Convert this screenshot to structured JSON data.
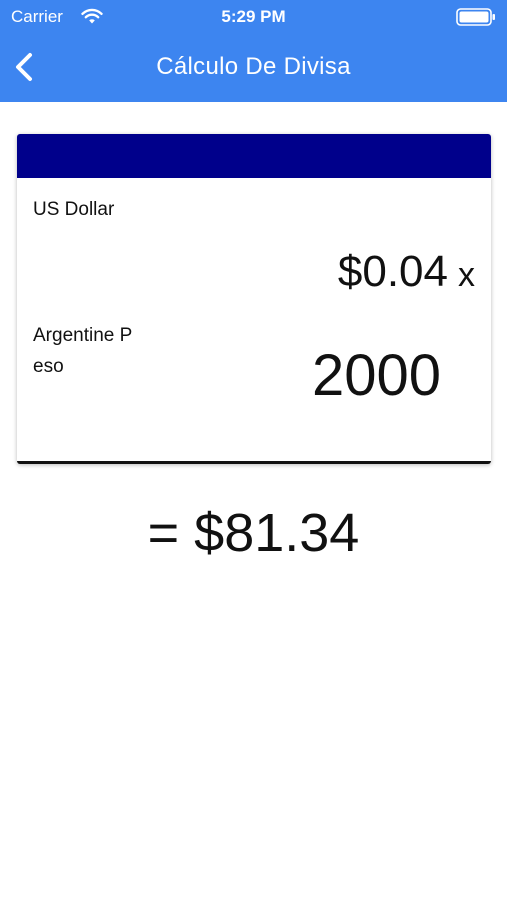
{
  "status_bar": {
    "carrier": "Carrier",
    "time": "5:29 PM",
    "icons": [
      "wifi-icon",
      "battery-icon"
    ]
  },
  "nav": {
    "back_icon": "chevron-left-icon",
    "title": "Cálculo De Divisa"
  },
  "converter": {
    "base_currency": "US Dollar",
    "rate": "$0.04",
    "rate_operator": "x",
    "target_currency": "Argentine Peso",
    "amount": "2000"
  },
  "result": "= $81.34",
  "colors": {
    "nav_background": "#3d85f0",
    "card_header": "#00008b",
    "text": "#111111"
  }
}
